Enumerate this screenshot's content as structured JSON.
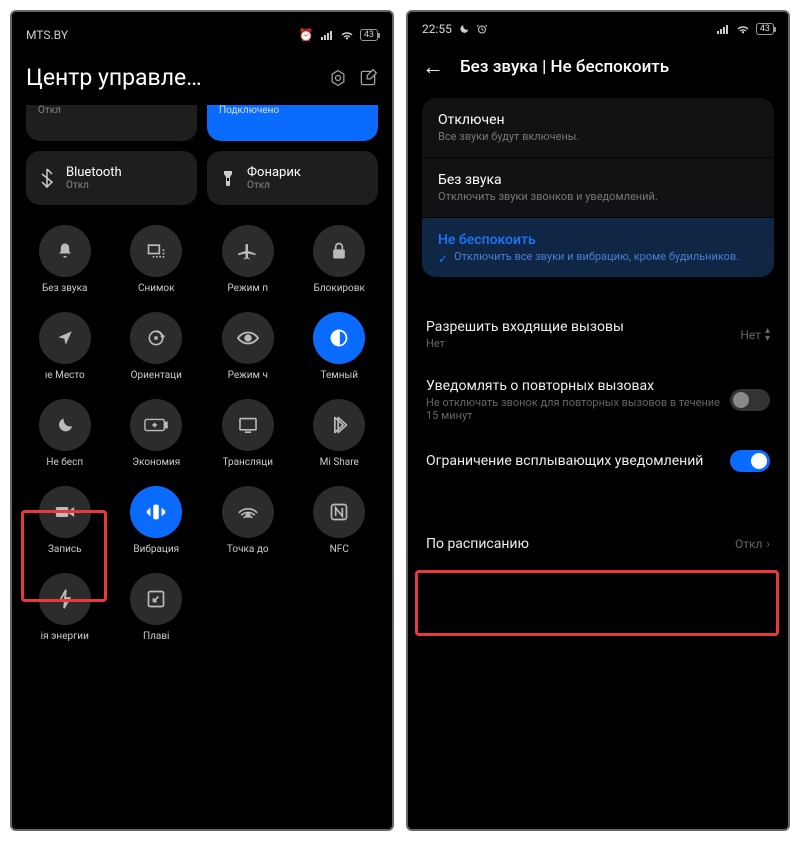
{
  "left": {
    "statusbar": {
      "carrier": "MTS.BY",
      "alarm": "⏰",
      "battery": "43"
    },
    "title": "Центр управле…",
    "tile_off": {
      "sub": "Откл"
    },
    "tile_connected": {
      "sub": "Подключено"
    },
    "tile_bluetooth": {
      "main": "Bluetooth",
      "sub": "Откл"
    },
    "tile_flash": {
      "main": "Фонарик",
      "sub": "Откл"
    },
    "toggles": [
      {
        "label": "Без звука"
      },
      {
        "label": "Снимок"
      },
      {
        "label": "Режим п"
      },
      {
        "label": "Блокировк"
      },
      {
        "label": "ıe   Место"
      },
      {
        "label": "Ориентаци"
      },
      {
        "label": "Режим ч"
      },
      {
        "label": "Темный"
      },
      {
        "label": "Не бесп"
      },
      {
        "label": "Экономия"
      },
      {
        "label": "Трансляци"
      },
      {
        "label": "Mi Share"
      },
      {
        "label": "Запись"
      },
      {
        "label": "Вибрация"
      },
      {
        "label": "Точка до"
      },
      {
        "label": "NFC"
      },
      {
        "label": "ія энергии"
      },
      {
        "label": "Плаві"
      }
    ]
  },
  "right": {
    "statusbar": {
      "time": "22:55",
      "battery": "43"
    },
    "title": "Без звука | Не беспокоить",
    "options": [
      {
        "title": "Отключен",
        "sub": "Все звуки будут включены."
      },
      {
        "title": "Без звука",
        "sub": "Отключить звуки звонков и уведомлений."
      },
      {
        "title": "Не беспокоить",
        "sub": "Отключить все звуки и вибрацию, кроме будильников."
      }
    ],
    "settings": {
      "incoming": {
        "title": "Разрешить входящие вызовы",
        "sub": "Нет",
        "value": "Нет"
      },
      "repeat": {
        "title": "Уведомлять о повторных вызовах",
        "sub": "Не отключать звонок для повторных вызовов в течение 15 минут"
      },
      "popup": {
        "title": "Ограничение всплывающих уведомлений"
      },
      "schedule": {
        "title": "По расписанию",
        "value": "Откл"
      }
    }
  }
}
